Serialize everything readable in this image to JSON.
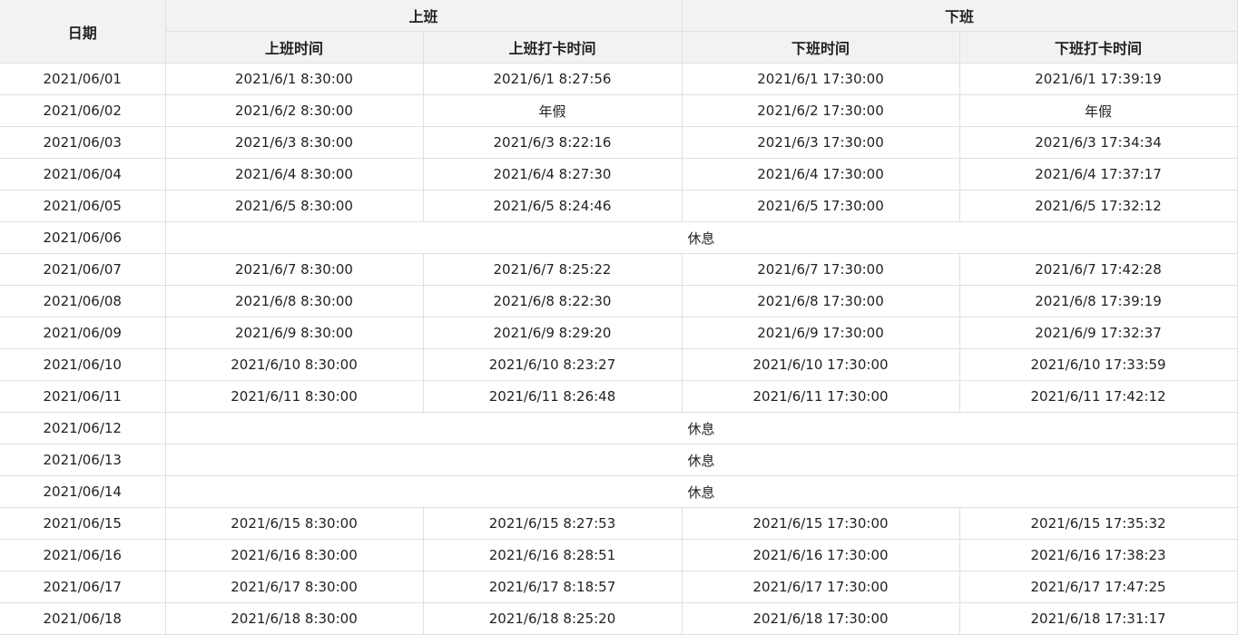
{
  "header": {
    "date": "日期",
    "group_on": "上班",
    "group_off": "下班",
    "on_time": "上班时间",
    "on_punch": "上班打卡时间",
    "off_time": "下班时间",
    "off_punch": "下班打卡时间"
  },
  "rows": [
    {
      "date": "2021/06/01",
      "on_time": "2021/6/1 8:30:00",
      "on_punch": "2021/6/1 8:27:56",
      "off_time": "2021/6/1 17:30:00",
      "off_punch": "2021/6/1 17:39:19"
    },
    {
      "date": "2021/06/02",
      "on_time": "2021/6/2 8:30:00",
      "on_punch": "年假",
      "off_time": "2021/6/2 17:30:00",
      "off_punch": "年假"
    },
    {
      "date": "2021/06/03",
      "on_time": "2021/6/3 8:30:00",
      "on_punch": "2021/6/3 8:22:16",
      "off_time": "2021/6/3 17:30:00",
      "off_punch": "2021/6/3 17:34:34"
    },
    {
      "date": "2021/06/04",
      "on_time": "2021/6/4 8:30:00",
      "on_punch": "2021/6/4 8:27:30",
      "off_time": "2021/6/4 17:30:00",
      "off_punch": "2021/6/4 17:37:17"
    },
    {
      "date": "2021/06/05",
      "on_time": "2021/6/5 8:30:00",
      "on_punch": "2021/6/5 8:24:46",
      "off_time": "2021/6/5 17:30:00",
      "off_punch": "2021/6/5 17:32:12"
    },
    {
      "date": "2021/06/06",
      "rest": "休息"
    },
    {
      "date": "2021/06/07",
      "on_time": "2021/6/7 8:30:00",
      "on_punch": "2021/6/7 8:25:22",
      "off_time": "2021/6/7 17:30:00",
      "off_punch": "2021/6/7 17:42:28"
    },
    {
      "date": "2021/06/08",
      "on_time": "2021/6/8 8:30:00",
      "on_punch": "2021/6/8 8:22:30",
      "off_time": "2021/6/8 17:30:00",
      "off_punch": "2021/6/8 17:39:19"
    },
    {
      "date": "2021/06/09",
      "on_time": "2021/6/9 8:30:00",
      "on_punch": "2021/6/9 8:29:20",
      "off_time": "2021/6/9 17:30:00",
      "off_punch": "2021/6/9 17:32:37"
    },
    {
      "date": "2021/06/10",
      "on_time": "2021/6/10 8:30:00",
      "on_punch": "2021/6/10 8:23:27",
      "off_time": "2021/6/10 17:30:00",
      "off_punch": "2021/6/10 17:33:59"
    },
    {
      "date": "2021/06/11",
      "on_time": "2021/6/11 8:30:00",
      "on_punch": "2021/6/11 8:26:48",
      "off_time": "2021/6/11 17:30:00",
      "off_punch": "2021/6/11 17:42:12"
    },
    {
      "date": "2021/06/12",
      "rest": "休息"
    },
    {
      "date": "2021/06/13",
      "rest": "休息"
    },
    {
      "date": "2021/06/14",
      "rest": "休息"
    },
    {
      "date": "2021/06/15",
      "on_time": "2021/6/15 8:30:00",
      "on_punch": "2021/6/15 8:27:53",
      "off_time": "2021/6/15 17:30:00",
      "off_punch": "2021/6/15 17:35:32"
    },
    {
      "date": "2021/06/16",
      "on_time": "2021/6/16 8:30:00",
      "on_punch": "2021/6/16 8:28:51",
      "off_time": "2021/6/16 17:30:00",
      "off_punch": "2021/6/16 17:38:23"
    },
    {
      "date": "2021/06/17",
      "on_time": "2021/6/17 8:30:00",
      "on_punch": "2021/6/17 8:18:57",
      "off_time": "2021/6/17 17:30:00",
      "off_punch": "2021/6/17 17:47:25"
    },
    {
      "date": "2021/06/18",
      "on_time": "2021/6/18 8:30:00",
      "on_punch": "2021/6/18 8:25:20",
      "off_time": "2021/6/18 17:30:00",
      "off_punch": "2021/6/18 17:31:17"
    }
  ]
}
